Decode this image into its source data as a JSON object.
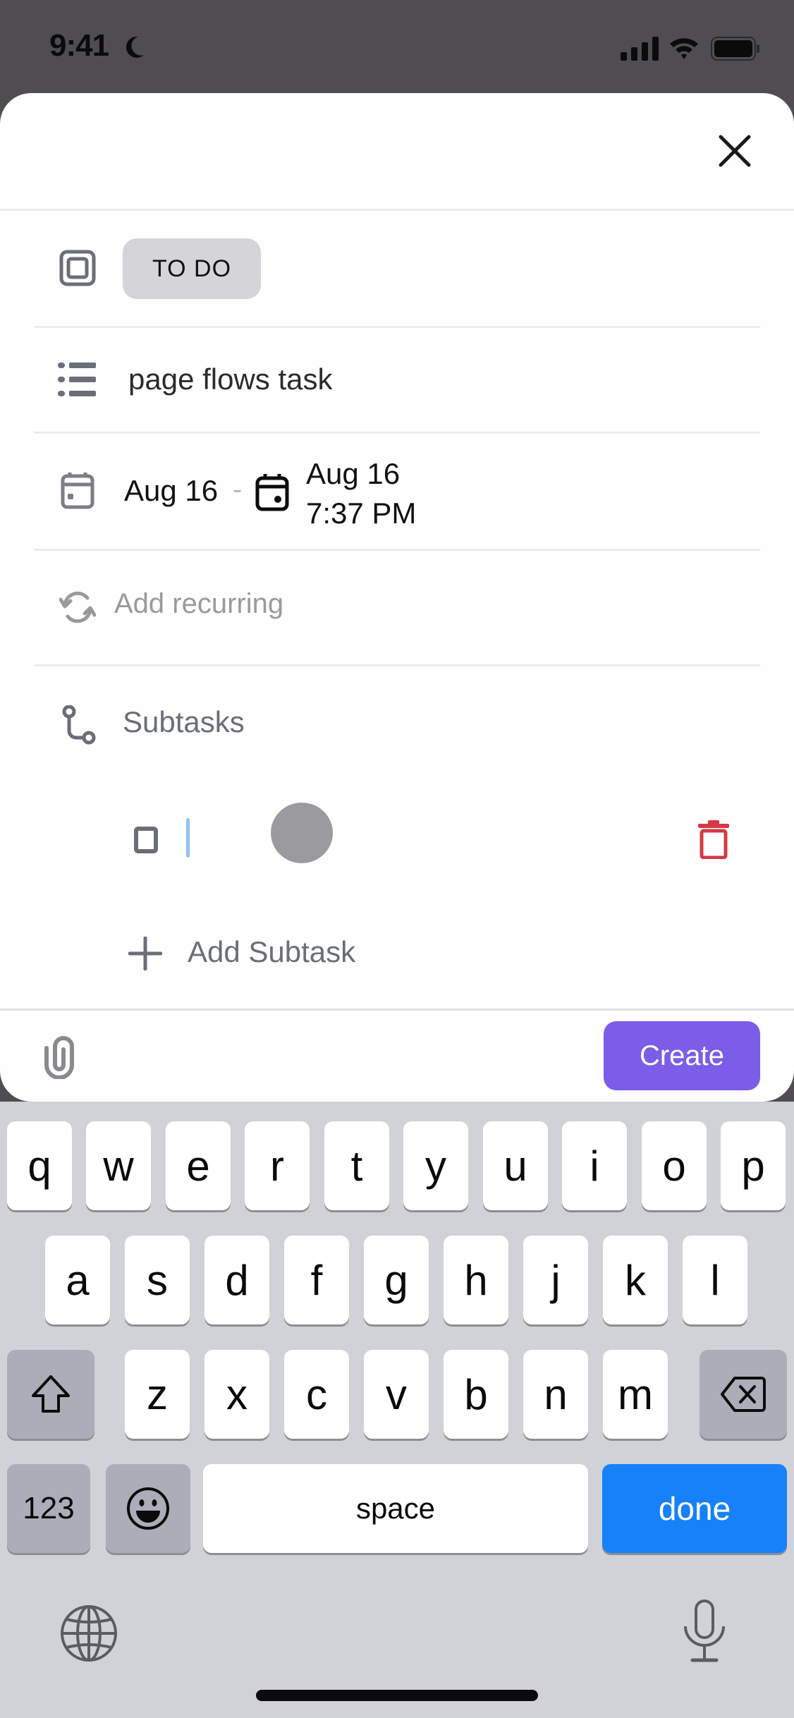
{
  "status_bar": {
    "time": "9:41",
    "icons": [
      "moon-icon",
      "signal-icon",
      "wifi-icon",
      "battery-icon"
    ]
  },
  "sheet": {
    "close_icon": "close-icon",
    "status": {
      "icon": "status-square-icon",
      "label": "TO DO"
    },
    "list": {
      "icon": "list-icon",
      "name": "page flows task"
    },
    "dates": {
      "icon": "calendar-icon",
      "start": "Aug 16",
      "separator": "-",
      "due_icon": "calendar-due-icon",
      "due_date": "Aug 16",
      "due_time": "7:37 PM"
    },
    "recurring": {
      "icon": "refresh-icon",
      "label": "Add recurring"
    },
    "subtasks": {
      "icon": "subtasks-icon",
      "label": "Subtasks",
      "items": [
        {
          "checked": false,
          "value": "",
          "delete_icon": "trash-icon"
        }
      ],
      "add_label": "Add Subtask",
      "add_icon": "plus-icon"
    },
    "footer": {
      "attach_icon": "paperclip-icon",
      "create_label": "Create",
      "accent_color": "#7b5de8"
    }
  },
  "keyboard": {
    "row1": [
      "q",
      "w",
      "e",
      "r",
      "t",
      "y",
      "u",
      "i",
      "o",
      "p"
    ],
    "row2": [
      "a",
      "s",
      "d",
      "f",
      "g",
      "h",
      "j",
      "k",
      "l"
    ],
    "row3": [
      "z",
      "x",
      "c",
      "v",
      "b",
      "n",
      "m"
    ],
    "numbers_label": "123",
    "space_label": "space",
    "done_label": "done",
    "done_color": "#1681f8"
  }
}
